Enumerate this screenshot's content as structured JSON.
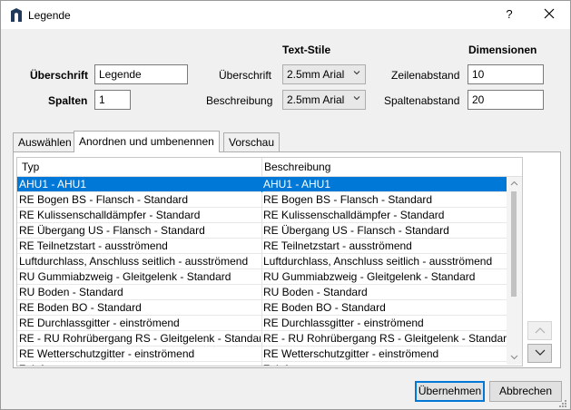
{
  "window": {
    "title": "Legende",
    "help_label": "?"
  },
  "form": {
    "heading_label": "Überschrift",
    "heading_value": "Legende",
    "columns_label": "Spalten",
    "columns_value": "1",
    "text_styles_title": "Text-Stile",
    "style_heading_label": "Überschrift",
    "style_heading_value": "2.5mm Arial",
    "style_description_label": "Beschreibung",
    "style_description_value": "2.5mm Arial",
    "dimensions_title": "Dimensionen",
    "line_spacing_label": "Zeilenabstand",
    "line_spacing_value": "10",
    "column_spacing_label": "Spaltenabstand",
    "column_spacing_value": "20"
  },
  "tabs": [
    {
      "label": "Auswählen",
      "active": false
    },
    {
      "label": "Anordnen und umbenennen",
      "active": true
    },
    {
      "label": "Vorschau",
      "active": false
    }
  ],
  "table": {
    "columns": [
      "Typ",
      "Beschreibung"
    ],
    "rows": [
      {
        "typ": "AHU1 - AHU1",
        "beschreibung": "AHU1 - AHU1",
        "selected": true
      },
      {
        "typ": "RE Bogen BS - Flansch - Standard",
        "beschreibung": "RE Bogen BS - Flansch - Standard"
      },
      {
        "typ": "RE Kulissenschalldämpfer - Standard",
        "beschreibung": "RE Kulissenschalldämpfer - Standard"
      },
      {
        "typ": "RE Übergang US - Flansch - Standard",
        "beschreibung": "RE Übergang US - Flansch - Standard"
      },
      {
        "typ": "RE Teilnetzstart - ausströmend",
        "beschreibung": "RE Teilnetzstart - ausströmend"
      },
      {
        "typ": "Luftdurchlass, Anschluss seitlich - ausströmend",
        "beschreibung": "Luftdurchlass, Anschluss seitlich - ausströmend"
      },
      {
        "typ": "RU Gummiabzweig - Gleitgelenk - Standard",
        "beschreibung": "RU Gummiabzweig - Gleitgelenk - Standard"
      },
      {
        "typ": "RU Boden - Standard",
        "beschreibung": "RU Boden - Standard"
      },
      {
        "typ": "RE Boden BO - Standard",
        "beschreibung": "RE Boden BO - Standard"
      },
      {
        "typ": "RE Durchlassgitter - einströmend",
        "beschreibung": "RE Durchlassgitter - einströmend"
      },
      {
        "typ": "RE - RU Rohrübergang RS - Gleitgelenk - Standard",
        "beschreibung": "RE - RU Rohrübergang RS - Gleitgelenk - Standard"
      },
      {
        "typ": "RE Wetterschutzgitter - einströmend",
        "beschreibung": "RE Wetterschutzgitter - einströmend"
      },
      {
        "typ": "Zuluft",
        "beschreibung": "Zuluft"
      }
    ]
  },
  "buttons": {
    "apply_label": "Übernehmen",
    "cancel_label": "Abbrechen"
  },
  "icons": {
    "app": "revit-app-icon",
    "close": "close-icon",
    "move_up": "arrow-up-icon",
    "move_down": "arrow-down-icon",
    "dropdown": "chevron-down-icon"
  },
  "colors": {
    "selection": "#0078d7",
    "accent_border": "#0078d7"
  }
}
